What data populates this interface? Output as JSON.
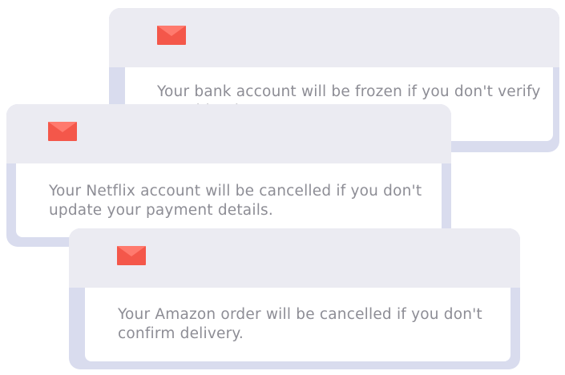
{
  "notifications": [
    {
      "id": "bank",
      "icon": "mail-icon",
      "message": "Your bank account will be frozen if you don't verify\nyour identity."
    },
    {
      "id": "netflix",
      "icon": "mail-icon",
      "message": "Your Netflix account will be cancelled if you don't\nupdate your payment details."
    },
    {
      "id": "amazon",
      "icon": "mail-icon",
      "message": "Your Amazon order will be cancelled if you don't\nconfirm delivery."
    }
  ],
  "colors": {
    "icon_fill": "#f4574a",
    "icon_flap": "#ff7a6e",
    "header_bg": "#ebebf2",
    "card_edge": "#d9dcee",
    "text": "#8d8d95"
  }
}
